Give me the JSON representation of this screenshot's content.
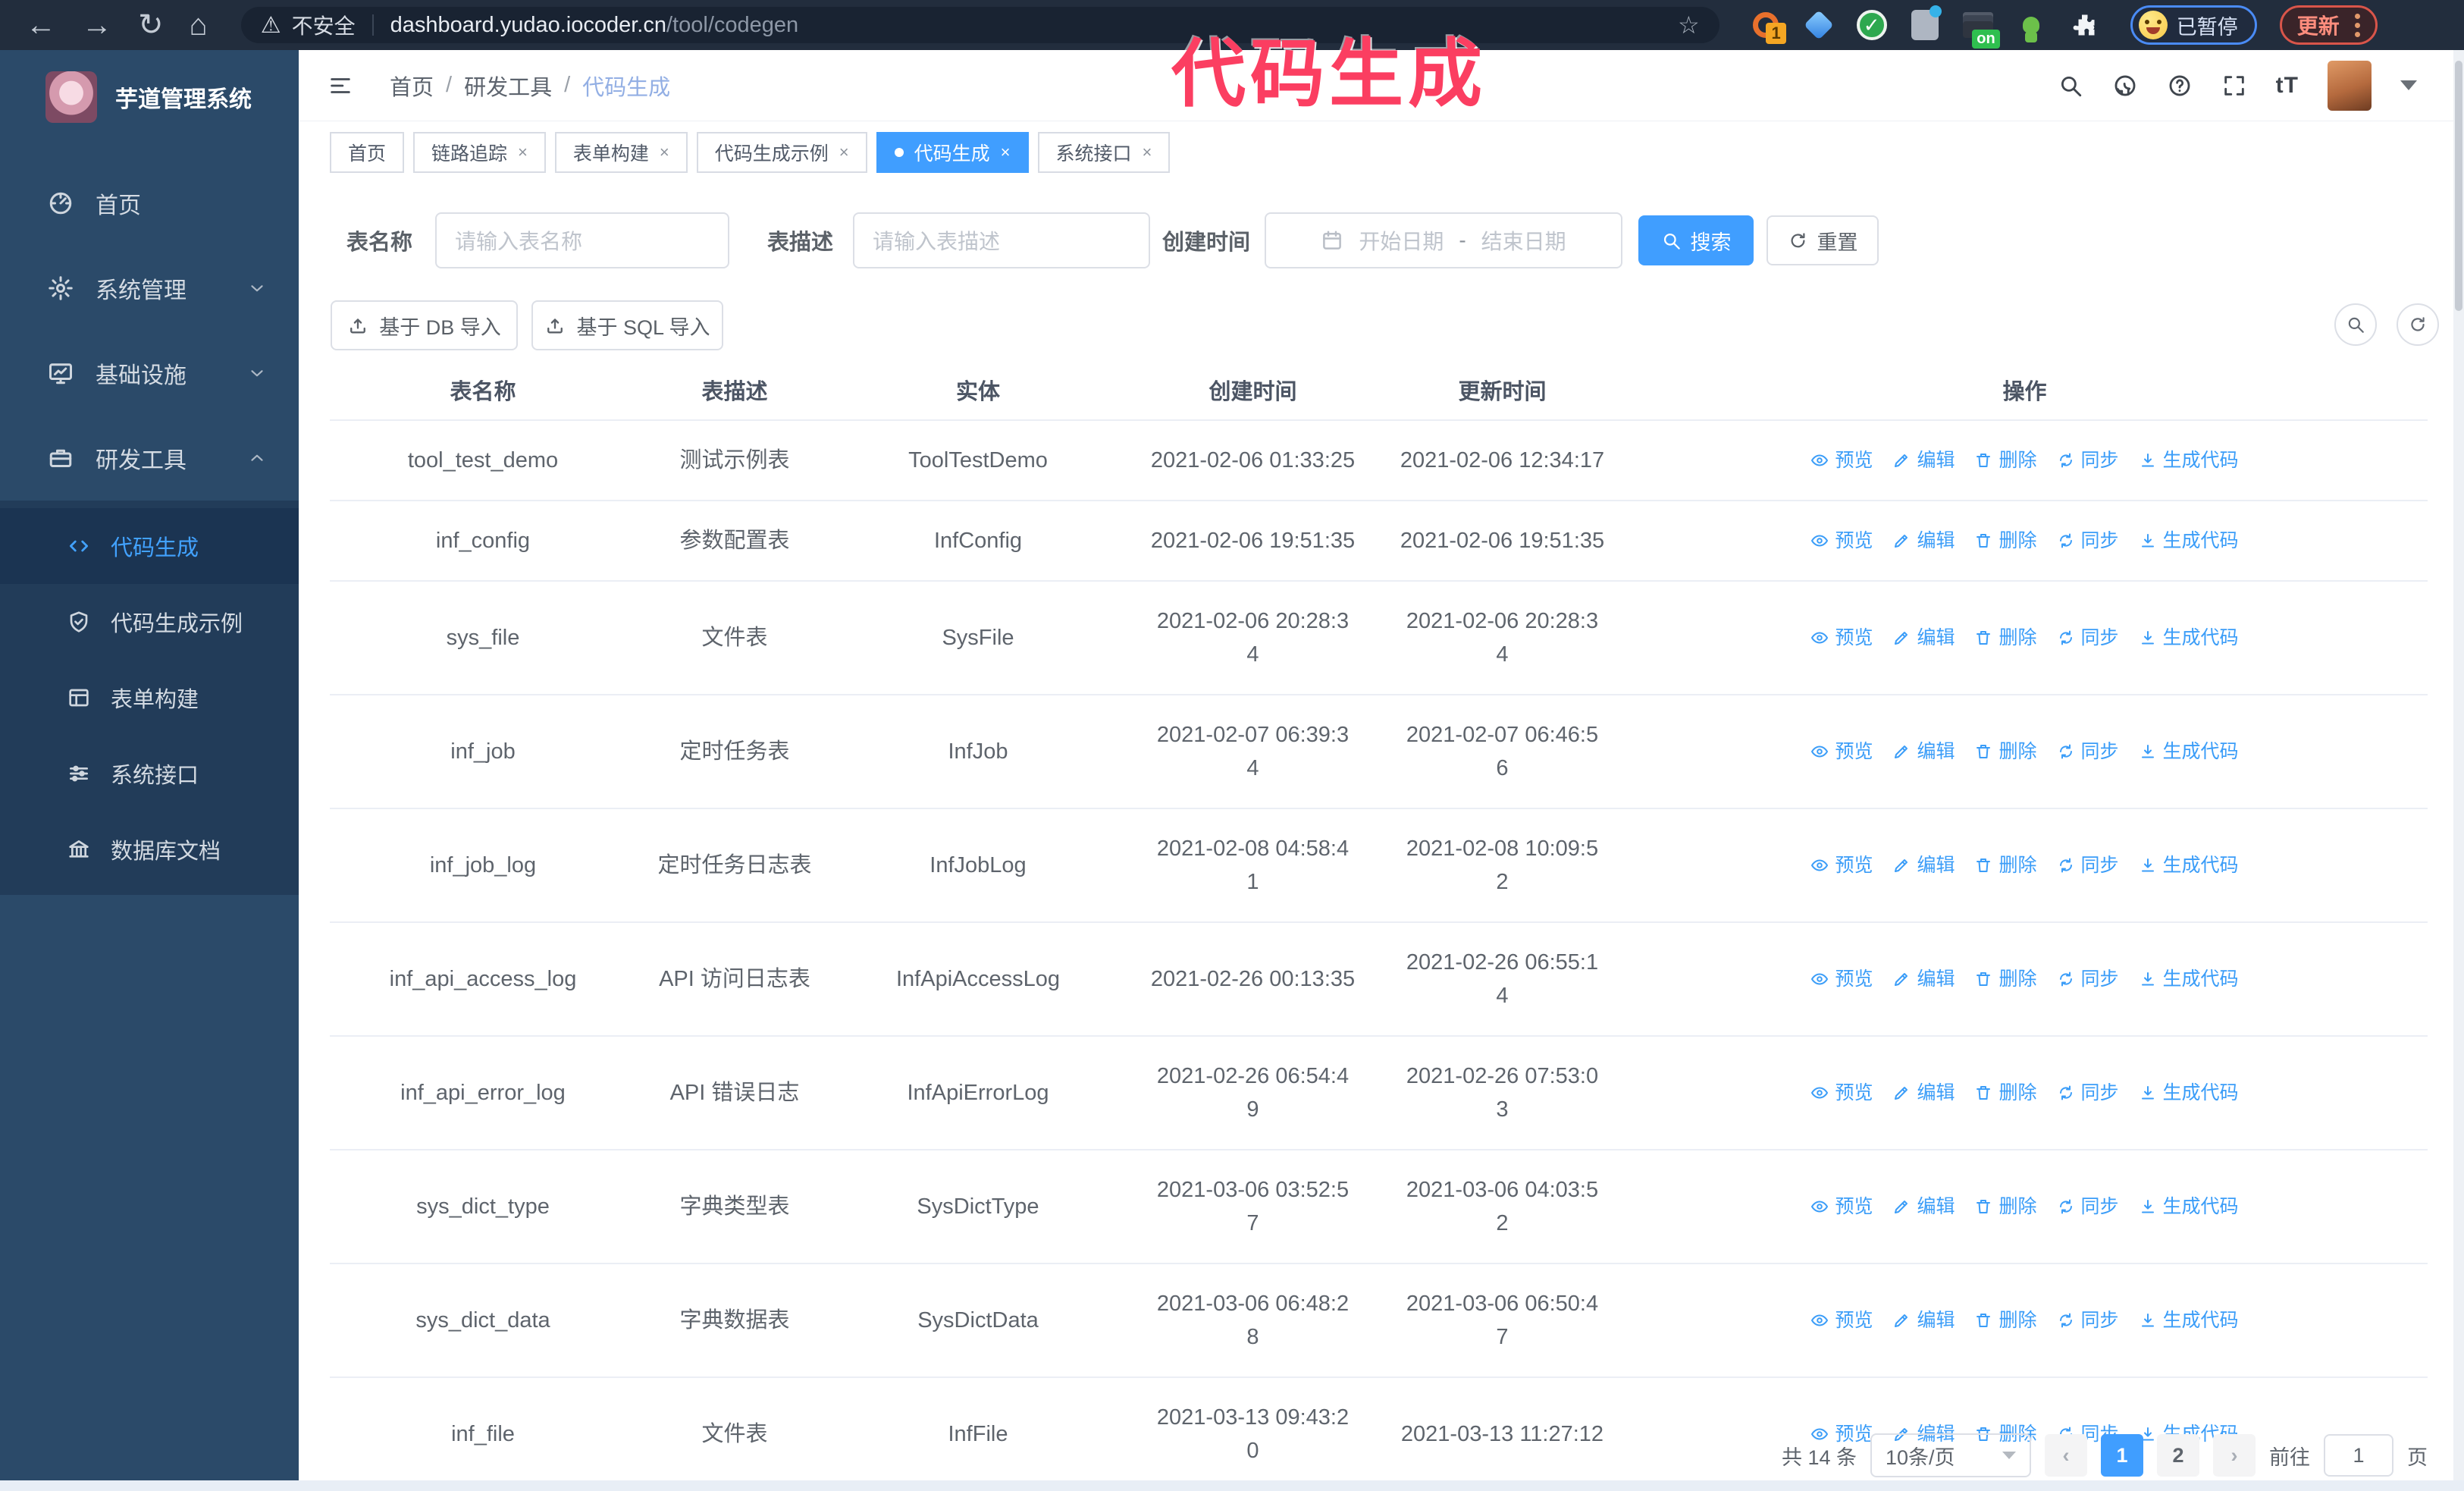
{
  "browser": {
    "security_label": "不安全",
    "url_host": "dashboard.yudao.iocoder.cn",
    "url_path": "/tool/codegen",
    "extension_badge_count": "1",
    "extension_badge_on": "on",
    "paused_badge": "已暂停",
    "update_button": "更新"
  },
  "annotation": {
    "title": "代码生成",
    "color": "#fb3e61"
  },
  "sidebar": {
    "app_title": "芋道管理系统",
    "items": [
      {
        "label": "首页",
        "icon": "dashboard-icon",
        "chevron": ""
      },
      {
        "label": "系统管理",
        "icon": "gear-icon",
        "chevron": "down"
      },
      {
        "label": "基础设施",
        "icon": "monitor-icon",
        "chevron": "down"
      },
      {
        "label": "研发工具",
        "icon": "toolbox-icon",
        "chevron": "up"
      }
    ],
    "submenu": [
      {
        "label": "代码生成",
        "icon": "code-icon",
        "active": true
      },
      {
        "label": "代码生成示例",
        "icon": "shield-check-icon",
        "active": false
      },
      {
        "label": "表单构建",
        "icon": "form-icon",
        "active": false
      },
      {
        "label": "系统接口",
        "icon": "sliders-icon",
        "active": false
      },
      {
        "label": "数据库文档",
        "icon": "columns-icon",
        "active": false
      }
    ]
  },
  "header": {
    "breadcrumb": [
      "首页",
      "研发工具",
      "代码生成"
    ],
    "breadcrumb_sep": "/"
  },
  "tabs": [
    {
      "label": "首页",
      "closable": false,
      "active": false
    },
    {
      "label": "链路追踪",
      "closable": true,
      "active": false
    },
    {
      "label": "表单构建",
      "closable": true,
      "active": false
    },
    {
      "label": "代码生成示例",
      "closable": true,
      "active": false
    },
    {
      "label": "代码生成",
      "closable": true,
      "active": true
    },
    {
      "label": "系统接口",
      "closable": true,
      "active": false
    }
  ],
  "filters": {
    "table_name_label": "表名称",
    "table_name_placeholder": "请输入表名称",
    "table_desc_label": "表描述",
    "table_desc_placeholder": "请输入表描述",
    "create_time_label": "创建时间",
    "date_start_placeholder": "开始日期",
    "date_separator": "-",
    "date_end_placeholder": "结束日期",
    "search_label": "搜索",
    "reset_label": "重置"
  },
  "toolbar": {
    "import_db_label": "基于 DB 导入",
    "import_sql_label": "基于 SQL 导入"
  },
  "table": {
    "columns": [
      "表名称",
      "表描述",
      "实体",
      "创建时间",
      "更新时间",
      "操作"
    ],
    "actions": [
      {
        "label": "预览",
        "icon": "eye-icon"
      },
      {
        "label": "编辑",
        "icon": "pencil-icon"
      },
      {
        "label": "删除",
        "icon": "trash-icon"
      },
      {
        "label": "同步",
        "icon": "sync-icon"
      },
      {
        "label": "生成代码",
        "icon": "download-icon"
      }
    ],
    "rows": [
      {
        "name": "tool_test_demo",
        "desc": "测试示例表",
        "entity": "ToolTestDemo",
        "created": "2021-02-06 01:33:25",
        "updated": "2021-02-06 12:34:17"
      },
      {
        "name": "inf_config",
        "desc": "参数配置表",
        "entity": "InfConfig",
        "created": "2021-02-06 19:51:35",
        "updated": "2021-02-06 19:51:35"
      },
      {
        "name": "sys_file",
        "desc": "文件表",
        "entity": "SysFile",
        "created": "2021-02-06 20:28:3\n4",
        "updated": "2021-02-06 20:28:3\n4"
      },
      {
        "name": "inf_job",
        "desc": "定时任务表",
        "entity": "InfJob",
        "created": "2021-02-07 06:39:3\n4",
        "updated": "2021-02-07 06:46:5\n6"
      },
      {
        "name": "inf_job_log",
        "desc": "定时任务日志表",
        "entity": "InfJobLog",
        "created": "2021-02-08 04:58:4\n1",
        "updated": "2021-02-08 10:09:5\n2"
      },
      {
        "name": "inf_api_access_log",
        "desc": "API 访问日志表",
        "entity": "InfApiAccessLog",
        "created": "2021-02-26 00:13:35",
        "updated": "2021-02-26 06:55:1\n4"
      },
      {
        "name": "inf_api_error_log",
        "desc": "API 错误日志",
        "entity": "InfApiErrorLog",
        "created": "2021-02-26 06:54:4\n9",
        "updated": "2021-02-26 07:53:0\n3"
      },
      {
        "name": "sys_dict_type",
        "desc": "字典类型表",
        "entity": "SysDictType",
        "created": "2021-03-06 03:52:5\n7",
        "updated": "2021-03-06 04:03:5\n2"
      },
      {
        "name": "sys_dict_data",
        "desc": "字典数据表",
        "entity": "SysDictData",
        "created": "2021-03-06 06:48:2\n8",
        "updated": "2021-03-06 06:50:4\n7"
      },
      {
        "name": "inf_file",
        "desc": "文件表",
        "entity": "InfFile",
        "created": "2021-03-13 09:43:2\n0",
        "updated": "2021-03-13 11:27:12"
      }
    ]
  },
  "pagination": {
    "total_label": "共 14 条",
    "page_size_value": "10条/页",
    "pages": [
      "1",
      "2"
    ],
    "active_page": "1",
    "goto_label": "前往",
    "goto_value": "1",
    "page_suffix": "页"
  }
}
